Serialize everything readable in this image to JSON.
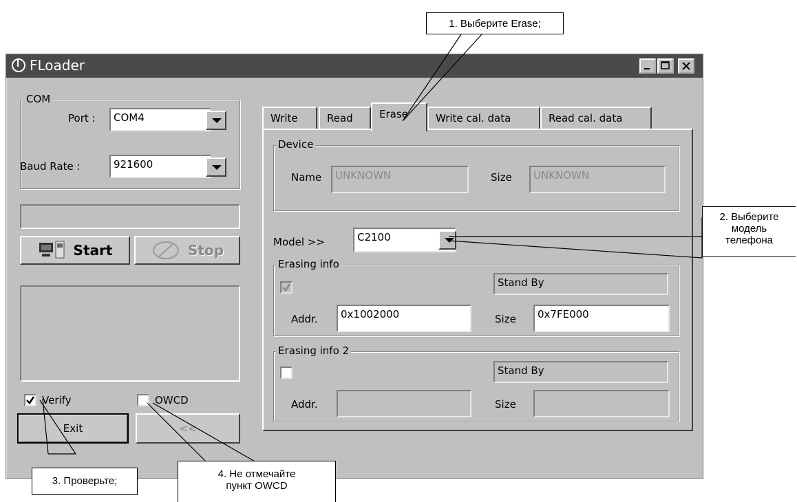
{
  "window": {
    "title": "FLoader"
  },
  "com": {
    "legend": "COM",
    "port_label": "Port :",
    "port_value": "COM4",
    "baud_label": "Baud Rate :",
    "baud_value": "921600"
  },
  "buttons": {
    "start": "Start",
    "stop": "Stop",
    "exit": "Exit",
    "collapse": "<<"
  },
  "options": {
    "verify": "Verify",
    "owcd": "OWCD"
  },
  "tabs": [
    "Write",
    "Read",
    "Erase",
    "Write cal. data",
    "Read cal. data"
  ],
  "device": {
    "legend": "Device",
    "name_label": "Name",
    "name_value": "UNKNOWN",
    "size_label": "Size",
    "size_value": "UNKNOWN"
  },
  "model": {
    "label": "Model >>",
    "value": "C2100"
  },
  "erasing1": {
    "legend": "Erasing info",
    "status": "Stand By",
    "addr_label": "Addr.",
    "addr_value": "0x1002000",
    "size_label": "Size",
    "size_value": "0x7FE000"
  },
  "erasing2": {
    "legend": "Erasing info 2",
    "status": "Stand By",
    "addr_label": "Addr.",
    "addr_value": "",
    "size_label": "Size",
    "size_value": ""
  },
  "callouts": {
    "c1": "1. Выберите Erase;",
    "c2": [
      "2. Выберите",
      "модель",
      "телефона"
    ],
    "c3": "3. Проверьте;",
    "c4": [
      "4. Не отмечайте",
      "пункт OWCD"
    ]
  }
}
